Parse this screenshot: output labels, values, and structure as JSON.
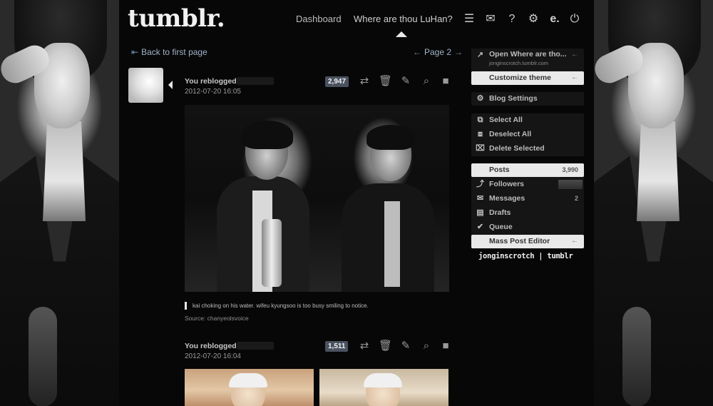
{
  "app": {
    "logo": "tumblr."
  },
  "header": {
    "nav": {
      "dashboard": "Dashboard",
      "blog": "Where are thou LuHan?"
    },
    "icons": [
      "list-icon",
      "mail-icon",
      "help-icon",
      "gear-icon",
      "editor-icon",
      "power-icon"
    ]
  },
  "pager": {
    "back": "Back to first page",
    "page": "Page 2"
  },
  "posts": [
    {
      "label": "You reblogged",
      "date": "2012-07-20 16:05",
      "notes": "2,947",
      "caption": "kai choking on his water. wifeu kyungsoo is too busy smiling to notice.",
      "source": "Source: chanyeolsvoice"
    },
    {
      "label": "You reblogged",
      "date": "2012-07-20 16:04",
      "notes": "1,511"
    }
  ],
  "sidebar": {
    "open_blog": "Open Where are tho...",
    "open_blog_url": "jonginscrotch.tumblr.com",
    "customize": "Customize theme",
    "settings": "Blog Settings",
    "select_all": "Select All",
    "deselect_all": "Deselect All",
    "delete_selected": "Delete Selected",
    "posts": "Posts",
    "posts_count": "3,990",
    "followers": "Followers",
    "messages": "Messages",
    "messages_count": "2",
    "drafts": "Drafts",
    "queue": "Queue",
    "mass_editor": "Mass Post Editor",
    "blog_handle": "jonginscrotch | tumblr"
  }
}
